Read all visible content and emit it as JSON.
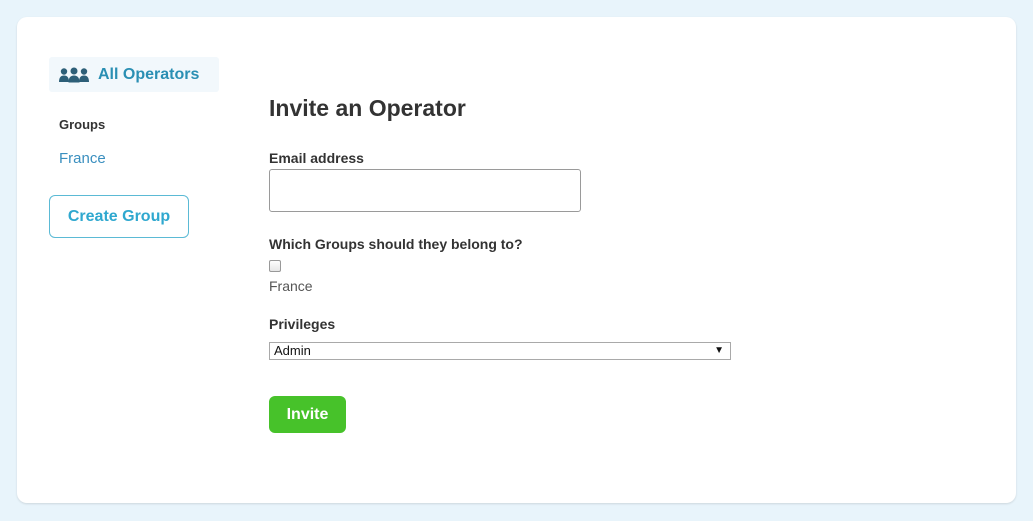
{
  "sidebar": {
    "all_operators_label": "All Operators",
    "all_operators_icon": "users-icon",
    "groups_heading": "Groups",
    "groups": [
      "France"
    ],
    "create_group_label": "Create Group"
  },
  "form": {
    "title": "Invite an Operator",
    "email_label": "Email address",
    "email_value": "",
    "email_placeholder": "",
    "groups_question": "Which Groups should they belong to?",
    "group_options": [
      {
        "label": "France",
        "checked": false
      }
    ],
    "privileges_label": "Privileges",
    "privileges_selected": "Admin",
    "invite_label": "Invite"
  },
  "colors": {
    "accent": "#2a8fb3",
    "link": "#3a8fbf",
    "primary_button": "#47c22a",
    "background": "#e8f4fb"
  }
}
